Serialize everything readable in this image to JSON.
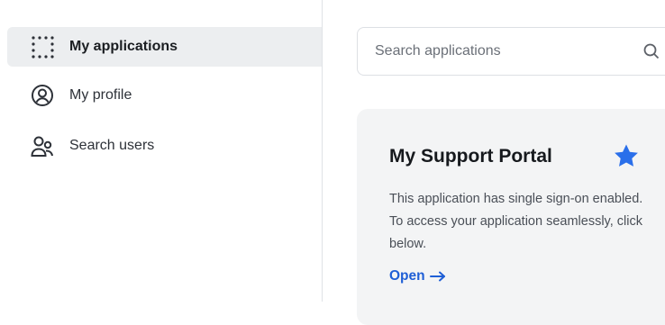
{
  "sidebar": {
    "items": [
      {
        "label": "My applications",
        "icon": "grid-icon",
        "active": true
      },
      {
        "label": "My profile",
        "icon": "user-circle-icon",
        "active": false
      },
      {
        "label": "Search users",
        "icon": "users-icon",
        "active": false
      }
    ]
  },
  "search": {
    "placeholder": "Search applications",
    "value": ""
  },
  "app_card": {
    "title": "My Support Portal",
    "description": "This application has single sign-on enabled. To access your application seamlessly, click below.",
    "link_label": "Open",
    "favorite": true,
    "favorite_icon": "star-icon"
  },
  "colors": {
    "accent": "#1f5fd6",
    "star": "#2a6fea",
    "active_nav_bg": "#eceef0",
    "card_bg": "#f3f4f5"
  }
}
